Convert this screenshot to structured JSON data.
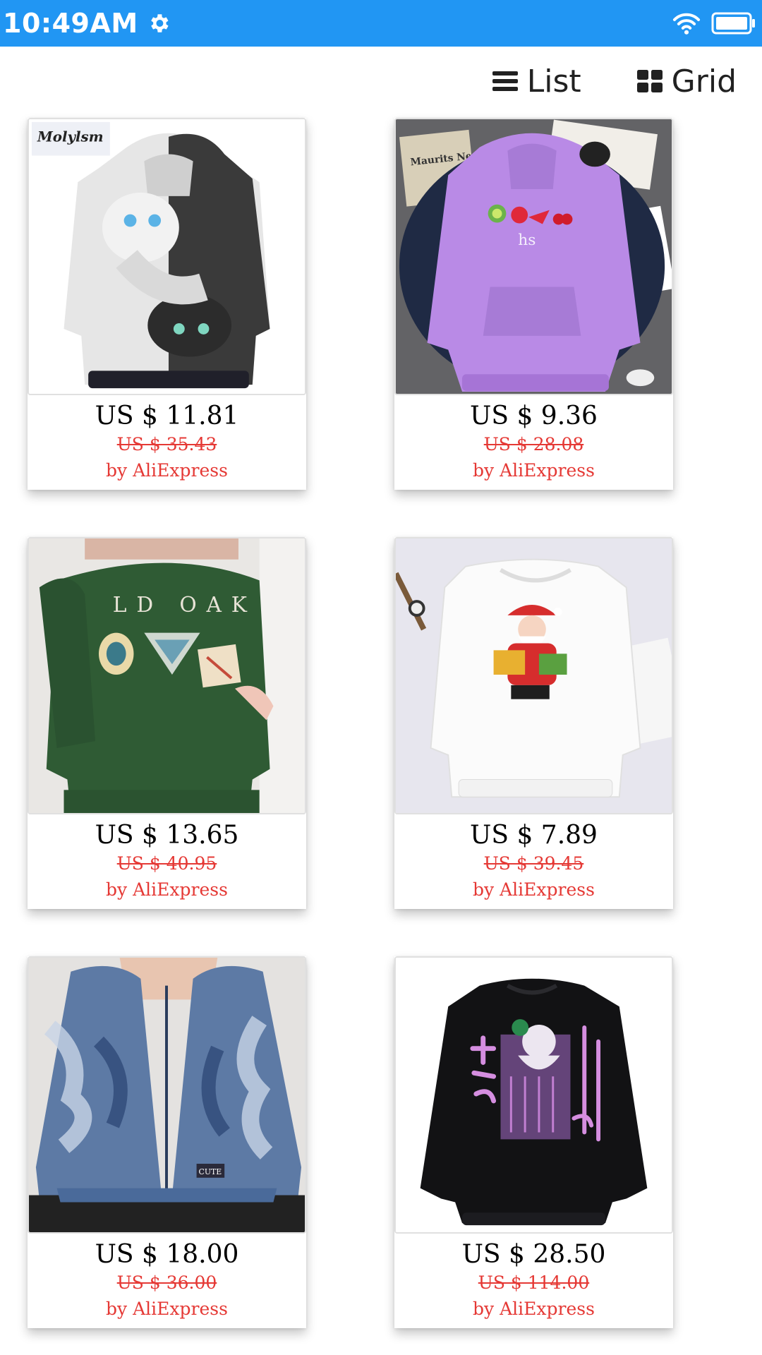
{
  "status_bar": {
    "time": "10:49AM",
    "icons": [
      "gear-icon",
      "wifi-icon",
      "battery-icon"
    ]
  },
  "view_toggle": {
    "list_label": "List",
    "grid_label": "Grid",
    "list_icon": "list-icon",
    "grid_icon": "grid-icon"
  },
  "colors": {
    "status_bar": "#2196f3",
    "old_price": "#e53935",
    "seller": "#e53935"
  },
  "products": [
    {
      "image": "hoodie-white-black-cat",
      "price": "US $ 11.81",
      "old_price": "US $ 35.43",
      "seller": "by AliExpress",
      "brand_mark": "Molylsm"
    },
    {
      "image": "hoodie-purple-fruits",
      "price": "US $ 9.36",
      "old_price": "US $ 28.08",
      "seller": "by AliExpress",
      "print_text": "hs",
      "newspaper_text": "Maurits News"
    },
    {
      "image": "sweatshirt-green-old-oak",
      "price": "US $ 13.65",
      "old_price": "US $ 40.95",
      "seller": "by AliExpress",
      "print_text": "LD OAK"
    },
    {
      "image": "sweatshirt-white-santa",
      "price": "US $ 7.89",
      "old_price": "US $ 39.45",
      "seller": "by AliExpress"
    },
    {
      "image": "hoodie-blue-tie-dye",
      "price": "US $ 18.00",
      "old_price": "US $ 36.00",
      "seller": "by AliExpress",
      "patch_text": "CUTE"
    },
    {
      "image": "sweatshirt-black-anime",
      "price": "US $ 28.50",
      "old_price": "US $ 114.00",
      "seller": "by AliExpress"
    }
  ]
}
